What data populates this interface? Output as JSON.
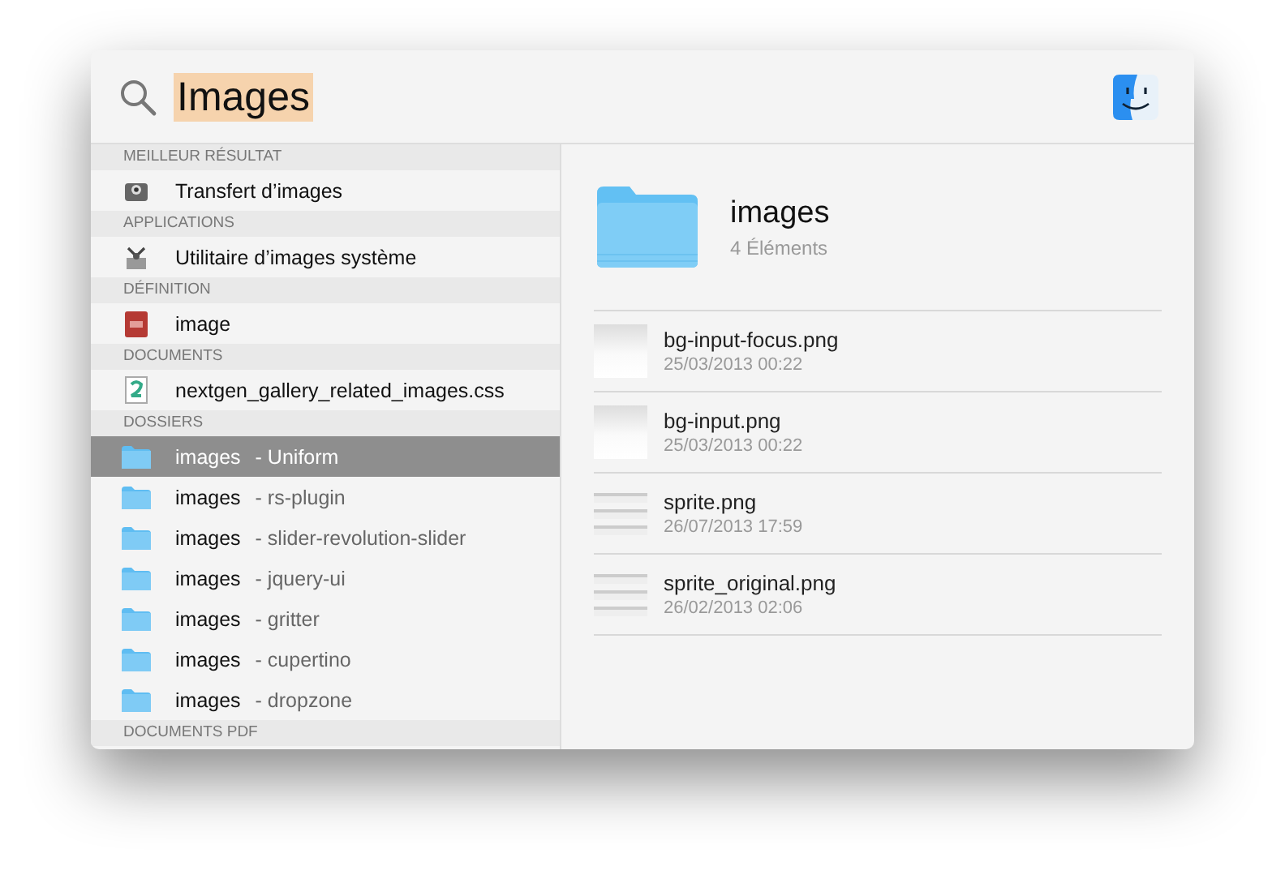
{
  "search": {
    "query": "Images"
  },
  "sections": [
    {
      "title": "MEILLEUR RÉSULTAT",
      "items": [
        {
          "kind": "camera-app",
          "name": "Transfert d’images",
          "selected": false
        }
      ]
    },
    {
      "title": "APPLICATIONS",
      "items": [
        {
          "kind": "utility-app",
          "name": "Utilitaire d’images système",
          "selected": false
        }
      ]
    },
    {
      "title": "DÉFINITION",
      "items": [
        {
          "kind": "dictionary",
          "name": "image",
          "selected": false
        }
      ]
    },
    {
      "title": "DOCUMENTS",
      "items": [
        {
          "kind": "css-file",
          "name": "nextgen_gallery_related_images.css",
          "selected": false
        }
      ]
    },
    {
      "title": "DOSSIERS",
      "items": [
        {
          "kind": "folder",
          "name": "images",
          "path": "- Uniform",
          "selected": true
        },
        {
          "kind": "folder",
          "name": "images",
          "path": "- rs-plugin",
          "selected": false
        },
        {
          "kind": "folder",
          "name": "images",
          "path": "- slider-revolution-slider",
          "selected": false
        },
        {
          "kind": "folder",
          "name": "images",
          "path": "- jquery-ui",
          "selected": false
        },
        {
          "kind": "folder",
          "name": "images",
          "path": "- gritter",
          "selected": false
        },
        {
          "kind": "folder",
          "name": "images",
          "path": "- cupertino",
          "selected": false
        },
        {
          "kind": "folder",
          "name": "images",
          "path": "- dropzone",
          "selected": false
        }
      ]
    },
    {
      "title": "DOCUMENTS PDF"
    }
  ],
  "preview": {
    "title": "images",
    "subtitle": "4 Éléments",
    "files": [
      {
        "kind": "gradient",
        "name": "bg-input-focus.png",
        "date": "25/03/2013 00:22"
      },
      {
        "kind": "gradient",
        "name": "bg-input.png",
        "date": "25/03/2013 00:22"
      },
      {
        "kind": "sprite",
        "name": "sprite.png",
        "date": "26/07/2013 17:59"
      },
      {
        "kind": "sprite",
        "name": "sprite_original.png",
        "date": "26/02/2013 02:06"
      }
    ]
  }
}
